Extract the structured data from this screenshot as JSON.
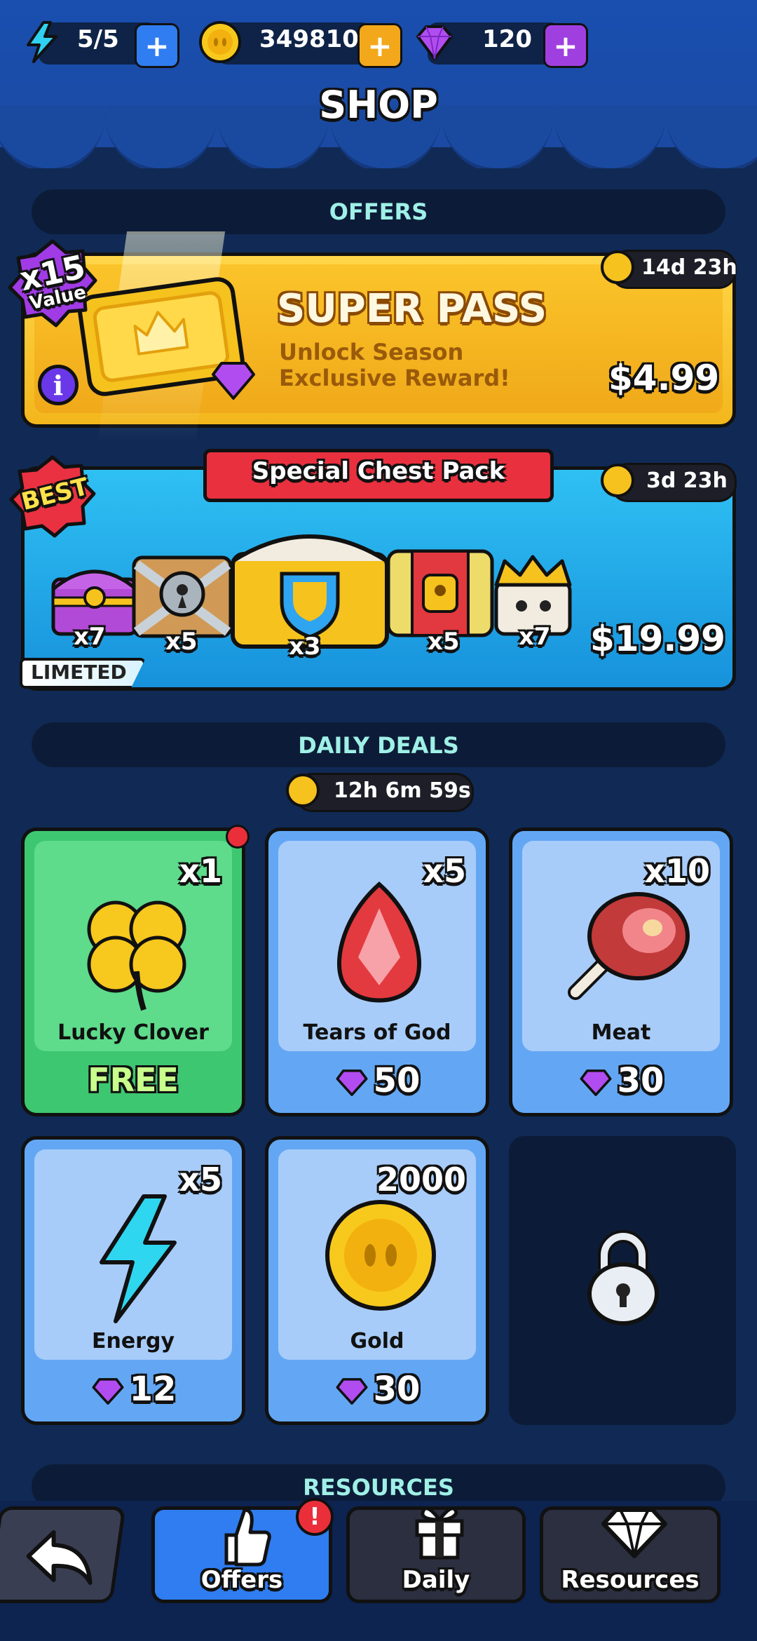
{
  "resources": {
    "energy": "5/5",
    "gold": "349810",
    "gems": "120"
  },
  "title": "SHOP",
  "sections": {
    "offers": "OFFERS",
    "daily_deals": "DAILY DEALS",
    "resources": "RESOURCES"
  },
  "super_pass": {
    "badge_top": "x15",
    "badge_bottom": "Value",
    "timer": "14d 23h",
    "title": "SUPER PASS",
    "description": "Unlock Season Exclusive Reward!",
    "price": "$4.99"
  },
  "chest_pack": {
    "badge": "BEST",
    "title": "Special Chest Pack",
    "timer": "3d 23h",
    "tag": "LIMETED",
    "price": "$19.99",
    "quantities": [
      "x7",
      "x5",
      "x3",
      "x5",
      "x7"
    ]
  },
  "daily": {
    "timer": "12h 6m 59s",
    "cards": [
      {
        "name": "Lucky Clover",
        "amount": "x1",
        "price": "FREE"
      },
      {
        "name": "Tears of God",
        "amount": "x5",
        "price": "50"
      },
      {
        "name": "Meat",
        "amount": "x10",
        "price": "30"
      },
      {
        "name": "Energy",
        "amount": "x5",
        "price": "12"
      },
      {
        "name": "Gold",
        "amount": "2000",
        "price": "30"
      }
    ]
  },
  "nav": {
    "offers": "Offers",
    "daily": "Daily",
    "resources": "Resources"
  },
  "colors": {
    "background": "#102a55",
    "accent_gold": "#f5c21e",
    "accent_blue": "#2f7df0",
    "gem_purple": "#b14df0",
    "free_green": "#3ec771"
  }
}
